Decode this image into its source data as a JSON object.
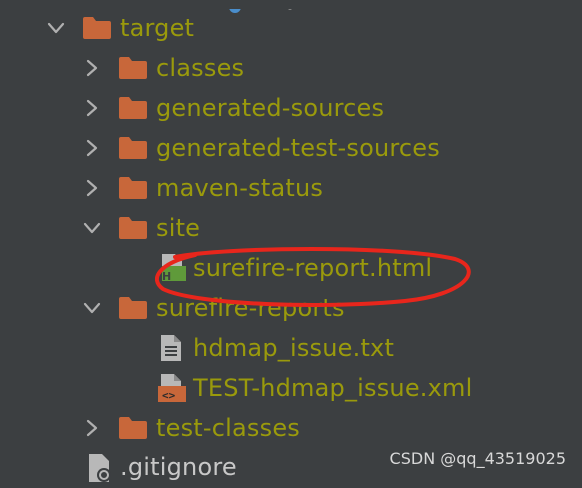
{
  "project_tree": {
    "items": [
      {
        "label": "target",
        "expanded": true,
        "kind": "folder"
      },
      {
        "label": "classes",
        "expanded": false,
        "kind": "folder"
      },
      {
        "label": "generated-sources",
        "expanded": false,
        "kind": "folder"
      },
      {
        "label": "generated-test-sources",
        "expanded": false,
        "kind": "folder"
      },
      {
        "label": "maven-status",
        "expanded": false,
        "kind": "folder"
      },
      {
        "label": "site",
        "expanded": true,
        "kind": "folder"
      },
      {
        "label": "surefire-report.html",
        "kind": "html-file"
      },
      {
        "label": "surefire-reports",
        "expanded": true,
        "kind": "folder"
      },
      {
        "label": "hdmap_issue.txt",
        "kind": "text-file"
      },
      {
        "label": "TEST-hdmap_issue.xml",
        "kind": "xml-file"
      },
      {
        "label": "test-classes",
        "expanded": false,
        "kind": "folder"
      },
      {
        "label": ".gitignore",
        "kind": "gitignore-file"
      }
    ]
  },
  "colors": {
    "background": "#3c3f41",
    "excluded_label": "#9a9a0c",
    "folder_icon": "#c8673a",
    "annotation_circle": "#e8261c"
  },
  "watermark": {
    "text": "CSDN @qq_43519025"
  }
}
